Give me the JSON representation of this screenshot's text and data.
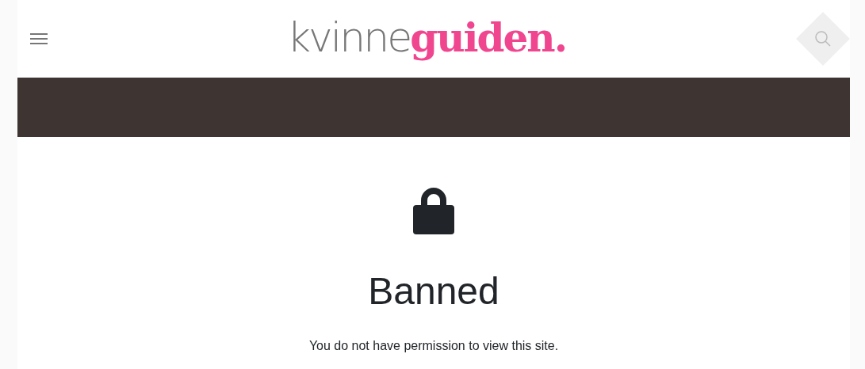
{
  "header": {
    "logo": [
      {
        "kind": "light",
        "text": "kvinne"
      },
      {
        "kind": "accent",
        "text": "guiden."
      }
    ]
  },
  "notice": {
    "title": "Banned",
    "message": "You do not have permission to view this site."
  }
}
